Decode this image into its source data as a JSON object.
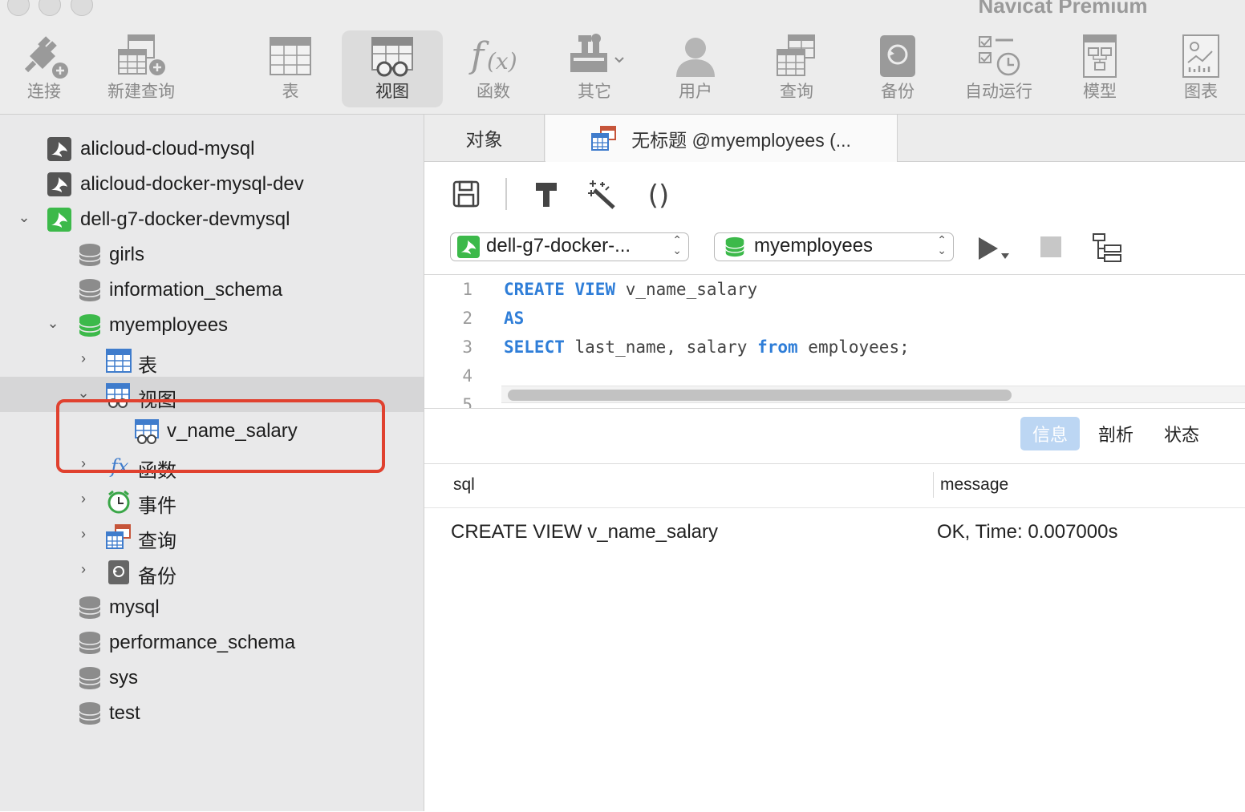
{
  "app": {
    "title": "Navicat Premium"
  },
  "toolbar": {
    "items": [
      {
        "label": "连接"
      },
      {
        "label": "新建查询"
      },
      {
        "label": "表"
      },
      {
        "label": "视图"
      },
      {
        "label": "函数"
      },
      {
        "label": "其它"
      },
      {
        "label": "用户"
      },
      {
        "label": "查询"
      },
      {
        "label": "备份"
      },
      {
        "label": "自动运行"
      },
      {
        "label": "模型"
      },
      {
        "label": "图表"
      }
    ]
  },
  "sidebar": {
    "connections": [
      {
        "label": "alicloud-cloud-mysql"
      },
      {
        "label": "alicloud-docker-mysql-dev"
      },
      {
        "label": "dell-g7-docker-devmysql"
      }
    ],
    "databases": {
      "girls": "girls",
      "information_schema": "information_schema",
      "myemployees": "myemployees",
      "mysql": "mysql",
      "performance_schema": "performance_schema",
      "sys": "sys",
      "test": "test"
    },
    "myemployees_children": {
      "tables": "表",
      "views": "视图",
      "view_item": "v_name_salary",
      "functions": "函数",
      "events": "事件",
      "queries": "查询",
      "backups": "备份"
    }
  },
  "tabs": {
    "objects": "对象",
    "query": "无标题 @myemployees (..."
  },
  "query_toolbar": {
    "connection_select": "dell-g7-docker-...",
    "database_select": "myemployees"
  },
  "editor": {
    "line_numbers": [
      "1",
      "2",
      "3",
      "4",
      "5"
    ],
    "line1": {
      "kw": "CREATE VIEW",
      "rest": " v_name_salary"
    },
    "line2": {
      "kw": "AS"
    },
    "line3": {
      "kw1": "SELECT",
      "mid": " last_name, salary ",
      "kw2": "from",
      "rest": " employees;"
    }
  },
  "results": {
    "segments": [
      "信息",
      "剖析",
      "状态"
    ],
    "columns": [
      "sql",
      "message"
    ],
    "rows": [
      {
        "sql": "CREATE VIEW v_name_salary",
        "message": "OK, Time: 0.007000s"
      }
    ]
  },
  "colors": {
    "keyword": "#2f7ed8",
    "connection_green": "#3cb94a",
    "highlight_red": "#e0412f",
    "segment_active": "#bcd6f3"
  }
}
